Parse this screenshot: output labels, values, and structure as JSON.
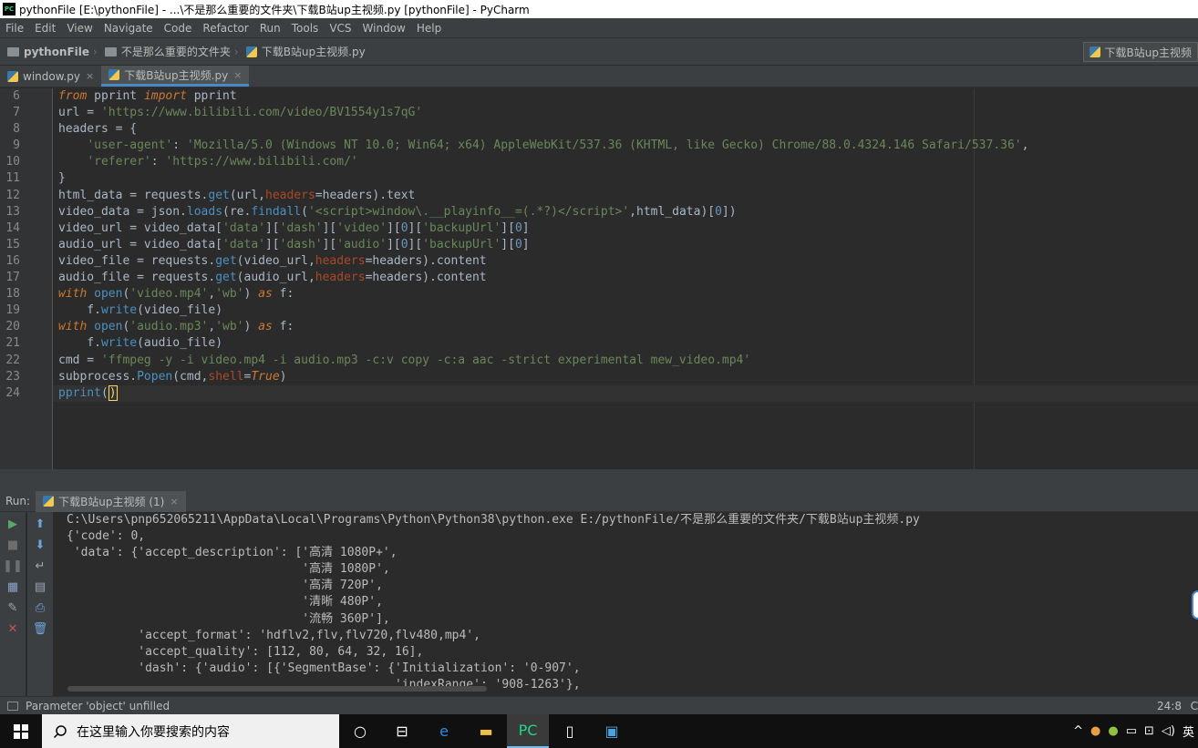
{
  "window": {
    "title": "pythonFile [E:\\pythonFile] - ...\\不是那么重要的文件夹\\下载B站up主视频.py [pythonFile] - PyCharm",
    "app_icon": "PC"
  },
  "menu": [
    "File",
    "Edit",
    "View",
    "Navigate",
    "Code",
    "Refactor",
    "Run",
    "Tools",
    "VCS",
    "Window",
    "Help"
  ],
  "breadcrumb": {
    "project": "pythonFile",
    "folder": "不是那么重要的文件夹",
    "file": "下载B站up主视频.py",
    "run_config": "下载B站up主视频"
  },
  "tabs": [
    {
      "label": "window.py",
      "close": "×"
    },
    {
      "label": "下载B站up主视频.py",
      "close": "×"
    }
  ],
  "editor": {
    "line_numbers": [
      "6",
      "7",
      "8",
      "9",
      "10",
      "11",
      "12",
      "13",
      "14",
      "15",
      "16",
      "17",
      "18",
      "19",
      "20",
      "21",
      "22",
      "23",
      "24"
    ]
  },
  "run_panel": {
    "label": "Run:",
    "tab": "下载B站up主视频 (1)",
    "close": "×",
    "output": [
      "C:\\Users\\pnp652065211\\AppData\\Local\\Programs\\Python\\Python38\\python.exe E:/pythonFile/不是那么重要的文件夹/下载B站up主视频.py",
      "{'code': 0,",
      " 'data': {'accept_description': ['高清 1080P+',",
      "                                 '高清 1080P',",
      "                                 '高清 720P',",
      "                                 '清晰 480P',",
      "                                 '流畅 360P'],",
      "          'accept_format': 'hdflv2,flv,flv720,flv480,mp4',",
      "          'accept_quality': [112, 80, 64, 32, 16],",
      "          'dash': {'audio': [{'SegmentBase': {'Initialization': '0-907',",
      "                                              'indexRange': '908-1263'},"
    ]
  },
  "status": {
    "message": "Parameter 'object' unfilled",
    "position": "24:8",
    "extra": "C"
  },
  "taskbar": {
    "search_placeholder": "在这里输入你要搜索的内容",
    "ime": "英"
  }
}
